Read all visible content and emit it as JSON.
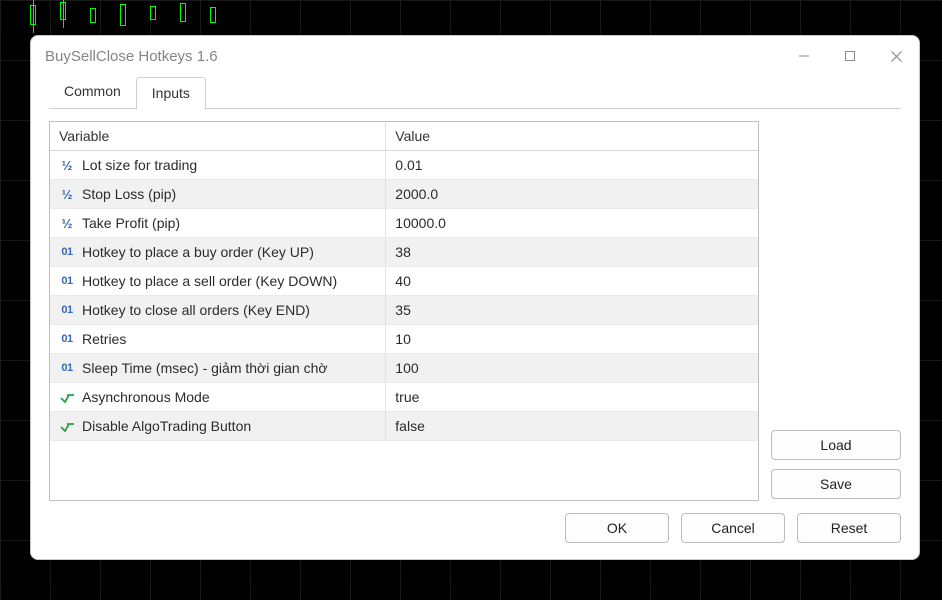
{
  "window": {
    "title": "BuySellClose Hotkeys 1.6"
  },
  "tabs": {
    "common": "Common",
    "inputs": "Inputs",
    "active": "inputs"
  },
  "table": {
    "header_variable": "Variable",
    "header_value": "Value",
    "rows": [
      {
        "type": "frac",
        "label": "Lot size for trading",
        "value": "0.01"
      },
      {
        "type": "frac",
        "label": "Stop Loss (pip)",
        "value": "2000.0"
      },
      {
        "type": "frac",
        "label": "Take Profit (pip)",
        "value": "10000.0"
      },
      {
        "type": "int",
        "label": "Hotkey to place a buy order (Key UP)",
        "value": "38"
      },
      {
        "type": "int",
        "label": "Hotkey to place a sell order (Key DOWN)",
        "value": "40"
      },
      {
        "type": "int",
        "label": "Hotkey to close all orders (Key END)",
        "value": "35"
      },
      {
        "type": "int",
        "label": "Retries",
        "value": "10"
      },
      {
        "type": "int",
        "label": "Sleep Time (msec) - giảm thời gian chờ",
        "value": "100"
      },
      {
        "type": "bool",
        "label": "Asynchronous Mode",
        "value": "true"
      },
      {
        "type": "bool",
        "label": "Disable AlgoTrading Button",
        "value": "false"
      }
    ]
  },
  "icons": {
    "frac": "½",
    "int": "01"
  },
  "buttons": {
    "load": "Load",
    "save": "Save",
    "ok": "OK",
    "cancel": "Cancel",
    "reset": "Reset"
  }
}
